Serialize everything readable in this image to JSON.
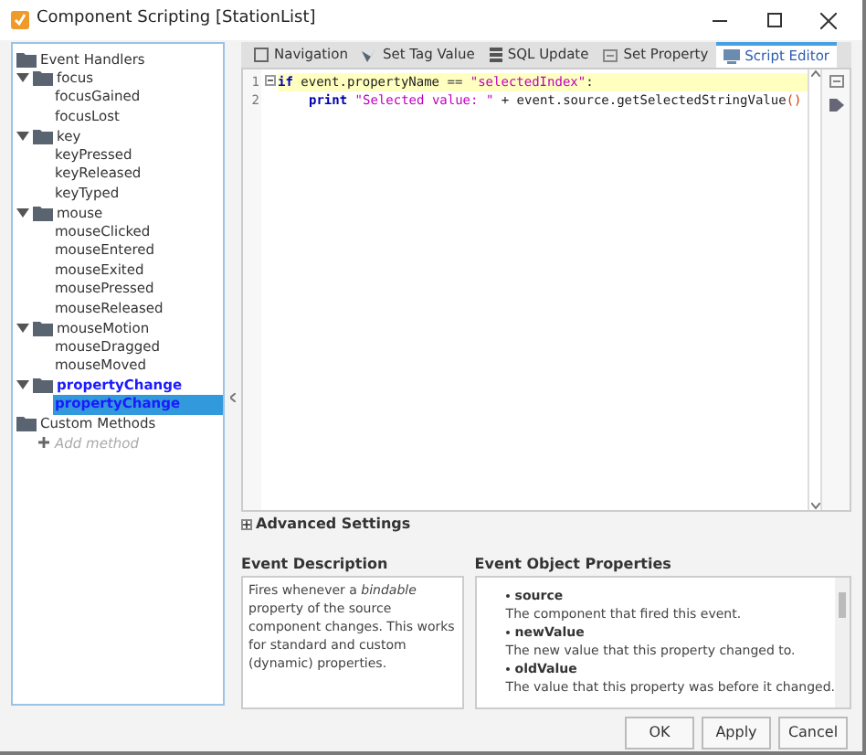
{
  "window": {
    "title": "Component Scripting [StationList]"
  },
  "tree": [
    {
      "label": "Event Handlers",
      "children": [
        {
          "label": "focus",
          "expanded": true,
          "children": [
            {
              "label": "focusGained",
              "selected": false
            },
            {
              "label": "focusLost",
              "selected": false
            }
          ]
        },
        {
          "label": "key",
          "expanded": true,
          "children": [
            {
              "label": "keyPressed",
              "selected": false
            },
            {
              "label": "keyReleased",
              "selected": false
            },
            {
              "label": "keyTyped",
              "selected": false
            }
          ]
        },
        {
          "label": "mouse",
          "expanded": true,
          "children": [
            {
              "label": "mouseClicked",
              "selected": false
            },
            {
              "label": "mouseEntered",
              "selected": false
            },
            {
              "label": "mouseExited",
              "selected": false
            },
            {
              "label": "mousePressed",
              "selected": false
            },
            {
              "label": "mouseReleased",
              "selected": false
            }
          ]
        },
        {
          "label": "mouseMotion",
          "expanded": true,
          "children": [
            {
              "label": "mouseDragged",
              "selected": false
            },
            {
              "label": "mouseMoved",
              "selected": false
            }
          ]
        },
        {
          "label": "propertyChange",
          "expanded": true,
          "configured": true,
          "children": [
            {
              "label": "propertyChange",
              "selected": true,
              "configured": true
            }
          ]
        }
      ]
    },
    {
      "label": "Custom Methods",
      "children": [
        {
          "label": "Add method",
          "kind": "add"
        }
      ]
    }
  ],
  "tabs": [
    {
      "label": "Navigation",
      "selected": false
    },
    {
      "label": "Set Tag Value",
      "selected": false
    },
    {
      "label": "SQL Update",
      "selected": false
    },
    {
      "label": "Set Property",
      "selected": false
    },
    {
      "label": "Script Editor",
      "selected": true
    }
  ],
  "editor": {
    "lines": [
      {
        "number": "1",
        "current": true,
        "indent": false,
        "tokens": [
          {
            "text": "if",
            "kind": "keyword"
          },
          {
            "text": " event.propertyName == ",
            "kind": "plain"
          },
          {
            "text": "\"selectedIndex\"",
            "kind": "string"
          },
          {
            "text": ":",
            "kind": "plain"
          }
        ]
      },
      {
        "number": "2",
        "current": false,
        "indent": true,
        "tokens": [
          {
            "text": "print ",
            "kind": "keyword"
          },
          {
            "text": "\"Selected value: \"",
            "kind": "string"
          },
          {
            "text": " + event.source.getSelectedStringValue",
            "kind": "plain"
          },
          {
            "text": "()",
            "kind": "paren"
          }
        ]
      }
    ]
  },
  "advanced_settings": {
    "label": "Advanced Settings",
    "expanded": false
  },
  "event_description": {
    "heading": "Event Description",
    "text": "Fires whenever a *bindable* property of the source component changes. This works for standard and custom (dynamic) properties."
  },
  "event_object_properties": {
    "heading": "Event Object Properties",
    "items": [
      {
        "name": "source",
        "description": "The component that fired this event."
      },
      {
        "name": "newValue",
        "description": "The new value that this property changed to."
      },
      {
        "name": "oldValue",
        "description": "The value that this property was before it changed."
      }
    ]
  },
  "buttons": [
    "OK",
    "Apply",
    "Cancel"
  ]
}
